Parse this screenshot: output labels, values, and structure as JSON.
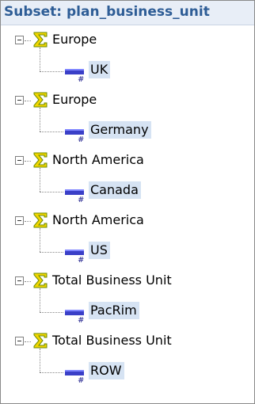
{
  "header": {
    "title": "Subset: plan_business_unit"
  },
  "nodes": [
    {
      "parent": "Europe",
      "child": "UK"
    },
    {
      "parent": "Europe",
      "child": "Germany"
    },
    {
      "parent": "North America",
      "child": "Canada"
    },
    {
      "parent": "North America",
      "child": "US"
    },
    {
      "parent": "Total Business Unit",
      "child": "PacRim"
    },
    {
      "parent": "Total Business Unit",
      "child": "ROW"
    }
  ],
  "icons": {
    "expander": "collapse-minus-icon",
    "consolidated": "sigma-icon",
    "leaf": "numeric-element-icon"
  },
  "colors": {
    "header_text": "#2e5d96",
    "header_bg": "#e8eef7",
    "selection_bg": "#d6e3f3",
    "sigma_fill": "#f2d600",
    "sigma_stroke": "#6a8a00"
  }
}
